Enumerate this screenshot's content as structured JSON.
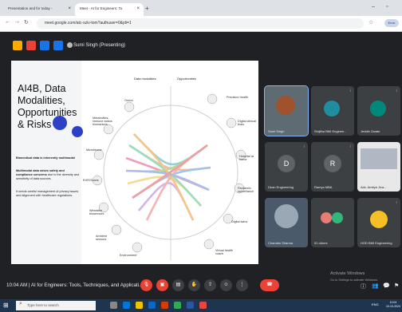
{
  "browser": {
    "tabs": [
      {
        "label": "Presentation and for today -"
      },
      {
        "label": "Meet - AI for Engineers: To"
      }
    ],
    "url": "meet.google.com/atc-sziv-tom?authuser=0&pli=1",
    "profile_label": "Error"
  },
  "meet": {
    "presenter_label": "Sumi Singh (Presenting)",
    "top_icon_colors": [
      "#f9ab00",
      "#ea4335",
      "#1a73e8",
      "#1a73e8"
    ]
  },
  "slide": {
    "title": "AI4B, Data Modalities, Opportunities & Risks",
    "para1_bold": "Biomedical data is inherently multimodal",
    "para2_bold": "Multimodal data raises safety and compliance concerns",
    "para2_rest": "due to the diversity and sensitivity of data sources.",
    "para3": "It needs careful management of privacy issues and alignment with healthcare regulations.",
    "col_left": "Data modalities",
    "col_right": "Opportunities",
    "left_labels": [
      "Omics",
      "Metabolites, immune status biomarkers",
      "Microbiome",
      "EHR/Scans",
      "Wearable biosensors",
      "Ambient sensors",
      "Environment"
    ],
    "right_labels": [
      "Precision health",
      "Digital clinical trials",
      "Hospital at home",
      "Pandemic surveillance",
      "Digital twins",
      "Virtual health coach"
    ]
  },
  "participants": [
    {
      "name": "Sumi Singh"
    },
    {
      "name": "Shijitha BMI Enginee..."
    },
    {
      "name": "Jeddie Zarate"
    },
    {
      "name": "Dean Engineering",
      "initial": "D"
    },
    {
      "name": "Ramya MBA",
      "initial": "R"
    },
    {
      "name": "Adv. Amitya Jiva..."
    },
    {
      "name": "Charubis Sharma"
    },
    {
      "name": "51 others"
    },
    {
      "name": "HOD BMI Engineering"
    }
  ],
  "controls": {
    "meeting_info": "10:04 AM  |  AI for Engineers: Tools, Techniques, and Applicati..."
  },
  "watermark": {
    "line1": "Activate Windows",
    "line2": "Go to Settings to activate Windows."
  },
  "taskbar": {
    "search_placeholder": "Type here to search",
    "time": "10:04",
    "date": "10-10-2024",
    "lang": "ENG"
  }
}
